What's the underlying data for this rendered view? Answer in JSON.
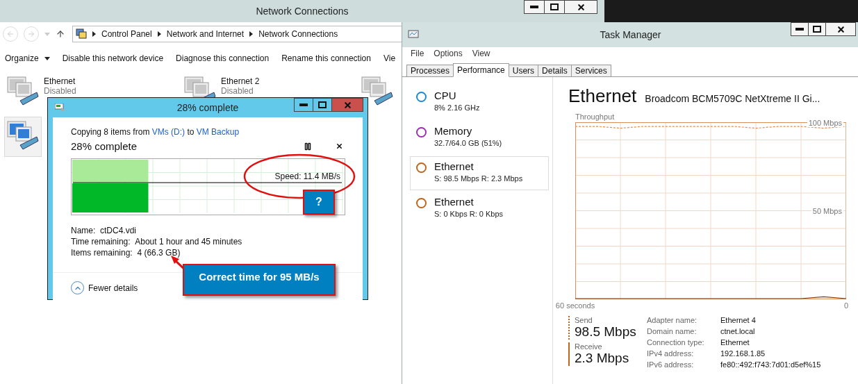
{
  "network_window": {
    "title": "Network Connections",
    "breadcrumb": [
      "Control Panel",
      "Network and Internet",
      "Network Connections"
    ],
    "toolbar": [
      {
        "label": "Organize",
        "kind": "menu"
      },
      {
        "label": "Disable this network device",
        "kind": "command"
      },
      {
        "label": "Diagnose this connection",
        "kind": "command"
      },
      {
        "label": "Rename this connection",
        "kind": "command"
      },
      {
        "label": "Vie",
        "kind": "command"
      }
    ],
    "adapters": [
      {
        "name": "Ethernet",
        "status": "Disabled",
        "selected": false
      },
      {
        "name": "Ethernet 2",
        "status": "Disabled",
        "selected": false
      },
      {
        "selected": false
      },
      {
        "selected": true
      }
    ]
  },
  "copy_dialog": {
    "title": "28% complete",
    "source": {
      "prefix": "Copying 8 items from ",
      "from": "VMs (D:)",
      "middle": " to ",
      "to": "VM Backup"
    },
    "heading": "28% complete",
    "level": 0.28,
    "speed": "Speed: 11.4 MB/s",
    "details": [
      {
        "label": "Name:",
        "value": "ctDC4.vdi"
      },
      {
        "label": "Time remaining:",
        "value": "About 1 hour and 45 minutes"
      },
      {
        "label": "Items remaining:",
        "value": "4 (66.3 GB)"
      }
    ],
    "toggle": "Fewer details"
  },
  "annotations": {
    "badge": "?",
    "callout": "Correct time for 95 MB/s"
  },
  "task_manager": {
    "title": "Task Manager",
    "menu": [
      "File",
      "Options",
      "View"
    ],
    "tabs": [
      {
        "label": "Processes",
        "selected": false
      },
      {
        "label": "Performance",
        "selected": true
      },
      {
        "label": "Users",
        "selected": false
      },
      {
        "label": "Details",
        "selected": false
      },
      {
        "label": "Services",
        "selected": false
      }
    ],
    "resources": [
      {
        "name": "CPU",
        "detail": "8% 2.16 GHz",
        "color": "#1e8ad6",
        "selected": false
      },
      {
        "name": "Memory",
        "detail": "32.7/64.0 GB (51%)",
        "color": "#9b30b0",
        "selected": false
      },
      {
        "name": "Ethernet",
        "detail": "S: 98.5 Mbps R: 2.3 Mbps",
        "color": "#c0651a",
        "selected": true
      },
      {
        "name": "Ethernet",
        "detail": "S: 0 Kbps R: 0 Kbps",
        "color": "#c0651a",
        "selected": false
      }
    ],
    "heading": "Ethernet",
    "adapter": "Broadcom BCM5709C NetXtreme II Gi...",
    "chart_data": {
      "type": "line",
      "title": "Throughput",
      "x": [
        60,
        55,
        50,
        45,
        40,
        35,
        30,
        25,
        20,
        15,
        10,
        5,
        0
      ],
      "xlim": [
        60,
        0
      ],
      "ylim": [
        0,
        100
      ],
      "xticks": [
        {
          "value": 60,
          "label": "60 seconds"
        },
        {
          "value": 0,
          "label": "0"
        }
      ],
      "yticks": [
        {
          "value": 100,
          "label": "100 Mbps"
        },
        {
          "value": 50,
          "label": "50 Mbps"
        }
      ],
      "series": [
        {
          "name": "Send",
          "color": "#e8894a",
          "line_style": "dashed",
          "values": [
            98,
            98,
            97,
            98,
            98,
            98,
            98,
            98,
            97,
            98,
            98,
            97,
            98
          ]
        },
        {
          "name": "Receive",
          "color": "#8a3a08",
          "line_style": "solid",
          "values": [
            0,
            0,
            0,
            0,
            0,
            0,
            0,
            0,
            0,
            0,
            0,
            1,
            0
          ]
        }
      ]
    },
    "send": {
      "value": "98.5 Mbps"
    },
    "receive": {
      "value": "2.3 Mbps"
    },
    "properties": [
      {
        "label": "Adapter name:",
        "value": "Ethernet 4"
      },
      {
        "label": "Domain name:",
        "value": "ctnet.local"
      },
      {
        "label": "Connection type:",
        "value": "Ethernet"
      },
      {
        "label": "IPv4 address:",
        "value": "192.168.1.85"
      },
      {
        "label": "IPv6 address:",
        "value": "fe80::492:f743:7d01:d5ef%15"
      }
    ]
  }
}
